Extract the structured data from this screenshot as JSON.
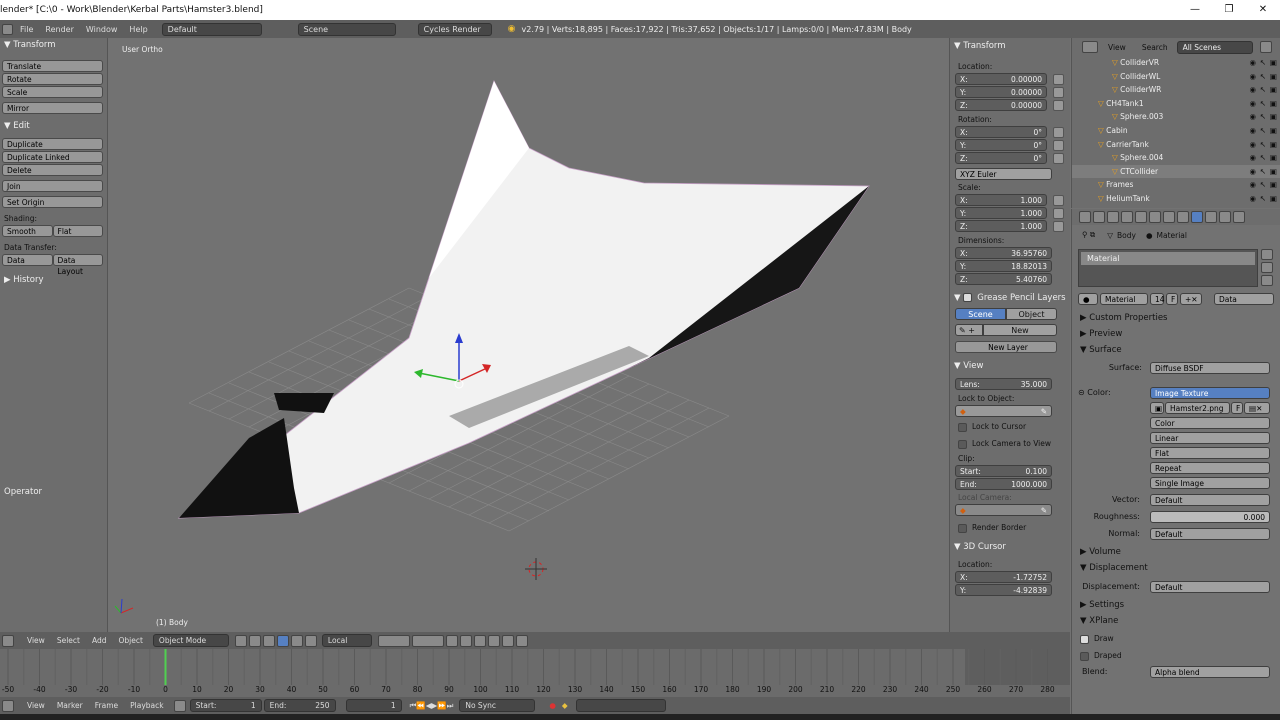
{
  "window": {
    "title": "lender* [C:\\0 - Work\\Blender\\Kerbal Parts\\Hamster3.blend]",
    "minimize": "—",
    "maximize": "❐",
    "close": "✕"
  },
  "topbar": {
    "menus": [
      "File",
      "Render",
      "Window",
      "Help"
    ],
    "layout": "Default",
    "scene": "Scene",
    "engine": "Cycles Render",
    "stats": "v2.79 | Verts:18,895 | Faces:17,922 | Tris:37,652 | Objects:1/17 | Lamps:0/0 | Mem:47.83M | Body"
  },
  "tools": {
    "transform_header": "Transform",
    "translate": "Translate",
    "rotate": "Rotate",
    "scale": "Scale",
    "mirror": "Mirror",
    "edit_header": "Edit",
    "duplicate": "Duplicate",
    "duplicate_linked": "Duplicate Linked",
    "delete": "Delete",
    "join": "Join",
    "set_origin": "Set Origin",
    "shading_label": "Shading:",
    "smooth": "Smooth",
    "flat": "Flat",
    "data_transfer_label": "Data Transfer:",
    "data": "Data",
    "data_layout": "Data Layout",
    "history_header": "History",
    "operator_header": "Operator"
  },
  "viewport": {
    "view_name": "User Ortho",
    "object_label": "(1) Body"
  },
  "npanel": {
    "transform_header": "Transform",
    "location_label": "Location:",
    "location": {
      "x": "0.00000",
      "y": "0.00000",
      "z": "0.00000"
    },
    "rotation_label": "Rotation:",
    "rotation": {
      "x": "0°",
      "y": "0°",
      "z": "0°"
    },
    "rotation_mode": "XYZ Euler",
    "scale_label": "Scale:",
    "scale": {
      "x": "1.000",
      "y": "1.000",
      "z": "1.000"
    },
    "dimensions_label": "Dimensions:",
    "dimensions": {
      "x": "36.95760",
      "y": "18.82013",
      "z": "5.40760"
    },
    "gp_header": "Grease Pencil Layers",
    "gp_scene": "Scene",
    "gp_object": "Object",
    "gp_new": "New",
    "gp_new_layer": "New Layer",
    "view_header": "View",
    "lens_label": "Lens:",
    "lens": "35.000",
    "lock_obj_label": "Lock to Object:",
    "lock_cursor": "Lock to Cursor",
    "lock_camera": "Lock Camera to View",
    "clip_label": "Clip:",
    "clip_start_label": "Start:",
    "clip_start": "0.100",
    "clip_end_label": "End:",
    "clip_end": "1000.000",
    "local_camera_label": "Local Camera:",
    "render_border": "Render Border",
    "cursor_header": "3D Cursor",
    "cursor_loc_label": "Location:",
    "cursor": {
      "x": "-1.72752",
      "y": "-4.92839"
    },
    "x_label": "X:",
    "y_label": "Y:",
    "z_label": "Z:"
  },
  "outliner": {
    "menu_view": "View",
    "menu_search": "Search",
    "filter": "All Scenes",
    "rows": [
      {
        "name": "ColliderVR",
        "indent": 2
      },
      {
        "name": "ColliderWL",
        "indent": 2
      },
      {
        "name": "ColliderWR",
        "indent": 2
      },
      {
        "name": "CH4Tank1",
        "indent": 1
      },
      {
        "name": "Sphere.003",
        "indent": 2
      },
      {
        "name": "Cabin",
        "indent": 1
      },
      {
        "name": "CarrierTank",
        "indent": 1
      },
      {
        "name": "Sphere.004",
        "indent": 2
      },
      {
        "name": "CTCollider",
        "indent": 2
      },
      {
        "name": "Frames",
        "indent": 1
      },
      {
        "name": "HeliumTank",
        "indent": 1
      }
    ]
  },
  "properties": {
    "crumb_body": "Body",
    "crumb_material": "Material",
    "slot": "Material",
    "mat_name": "Material",
    "mat_users": "14",
    "mat_f": "F",
    "mat_link": "Data",
    "custom_props": "Custom Properties",
    "preview": "Preview",
    "surface": "Surface",
    "surface_label": "Surface:",
    "surface_value": "Diffuse BSDF",
    "color_label": "Color:",
    "color_value": "Image Texture",
    "image": "Hamster2.png",
    "image_f": "F",
    "opt_color": "Color",
    "opt_linear": "Linear",
    "opt_flat": "Flat",
    "opt_repeat": "Repeat",
    "opt_single": "Single Image",
    "vector_label": "Vector:",
    "vector_value": "Default",
    "roughness_label": "Roughness:",
    "roughness_value": "0.000",
    "normal_label": "Normal:",
    "normal_value": "Default",
    "volume": "Volume",
    "displacement_header": "Displacement",
    "displacement_label": "Displacement:",
    "displacement_value": "Default",
    "settings": "Settings",
    "xplane": "XPlane",
    "draw": "Draw",
    "draped": "Draped",
    "blend_label": "Blend:",
    "blend_value": "Alpha blend"
  },
  "vheader": {
    "view": "View",
    "select": "Select",
    "add": "Add",
    "object": "Object",
    "mode": "Object Mode",
    "pivot": "Local"
  },
  "timeline": {
    "ticks": [
      "-50",
      "-40",
      "-30",
      "-20",
      "-10",
      "0",
      "10",
      "20",
      "30",
      "40",
      "50",
      "60",
      "70",
      "80",
      "90",
      "100",
      "110",
      "120",
      "130",
      "140",
      "150",
      "160",
      "170",
      "180",
      "190",
      "200",
      "210",
      "220",
      "230",
      "240",
      "250",
      "260",
      "270",
      "280"
    ],
    "current_frame": 0
  },
  "tlheader": {
    "view": "View",
    "marker": "Marker",
    "frame": "Frame",
    "playback": "Playback",
    "start_label": "Start:",
    "start": "1",
    "end_label": "End:",
    "end": "250",
    "current": "1",
    "sync": "No Sync"
  }
}
